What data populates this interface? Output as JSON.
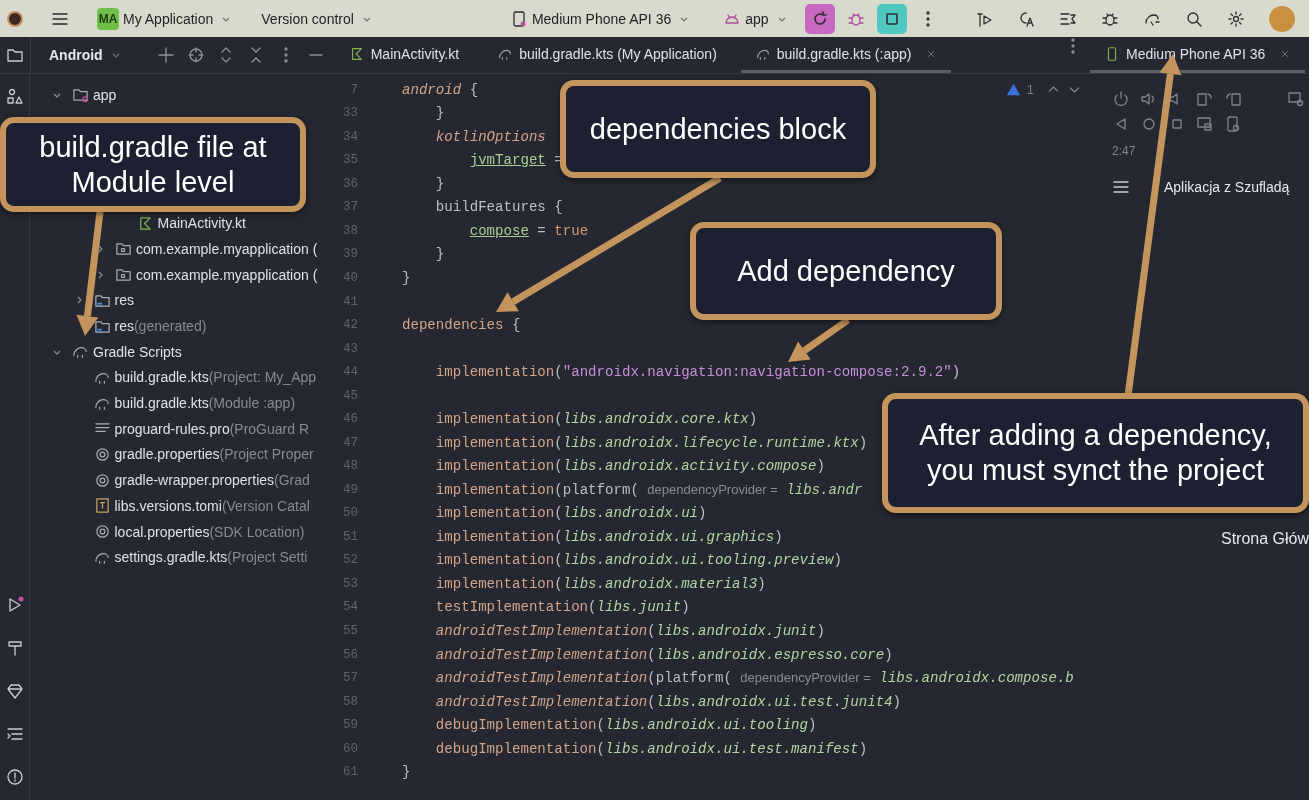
{
  "toolbar": {
    "project_badge": "MA",
    "project": "My Application",
    "vcs": "Version control",
    "device": "Medium Phone API 36",
    "run_config": "app"
  },
  "project_panel": {
    "view": "Android",
    "tree": [
      {
        "label": "app",
        "kind": "module",
        "expanded": true,
        "children": [
          {
            "kind": "covered",
            "children": [
              {
                "kind": "covered"
              }
            ]
          },
          {
            "kind": "covered",
            "children": [
              {
                "kind": "covered",
                "children": [
                  {
                    "label": "MainActivity.kt",
                    "kind": "kotlin"
                  }
                ]
              },
              {
                "label": "com.example.myapplication (",
                "kind": "package",
                "expanded": false
              },
              {
                "label": "com.example.myapplication (",
                "kind": "package",
                "expanded": false
              }
            ]
          },
          {
            "label": "res",
            "kind": "res",
            "expanded": false
          },
          {
            "label": "res",
            "hint": "(generated)",
            "kind": "res"
          }
        ]
      },
      {
        "label": "Gradle Scripts",
        "kind": "gradle",
        "expanded": true,
        "children": [
          {
            "label": "build.gradle.kts",
            "hint": "(Project: My_App",
            "kind": "gradle"
          },
          {
            "label": "build.gradle.kts",
            "hint": "(Module :app)",
            "kind": "gradle"
          },
          {
            "label": "proguard-rules.pro",
            "hint": "(ProGuard R",
            "kind": "text"
          },
          {
            "label": "gradle.properties",
            "hint": "(Project Proper",
            "kind": "settings"
          },
          {
            "label": "gradle-wrapper.properties",
            "hint": "(Grad",
            "kind": "settings"
          },
          {
            "label": "libs.versions.tomi",
            "hint": "(Version Catal",
            "kind": "catalog"
          },
          {
            "label": "local.properties",
            "hint": "(SDK Location)",
            "kind": "settings"
          },
          {
            "label": "settings.gradle.kts",
            "hint": "(Project Setti",
            "kind": "gradle"
          }
        ]
      }
    ]
  },
  "editor_tabs": [
    {
      "label": "MainActivity.kt",
      "kind": "kotlin",
      "selected": false
    },
    {
      "label": "build.gradle.kts (My Application)",
      "kind": "gradle",
      "selected": false
    },
    {
      "label": "build.gradle.kts (:app)",
      "kind": "gradle",
      "selected": true
    }
  ],
  "editor": {
    "warnings": "1",
    "lines": [
      {
        "number": "7",
        "tokens": [
          {
            "kind": "kw-i",
            "text": "android"
          },
          {
            "kind": "plain",
            "text": " {"
          }
        ]
      },
      {
        "number": "33",
        "tokens": [
          {
            "kind": "plain",
            "text": "    }"
          }
        ]
      },
      {
        "number": "34",
        "tokens": [
          {
            "kind": "kw-i",
            "text": "    kotlinOptions"
          }
        ]
      },
      {
        "number": "35",
        "tokens": [
          {
            "kind": "prop",
            "text": "        jvmTarget"
          },
          {
            "kind": "plain",
            "text": " ="
          }
        ]
      },
      {
        "number": "36",
        "tokens": [
          {
            "kind": "plain",
            "text": "    }"
          }
        ]
      },
      {
        "number": "37",
        "tokens": [
          {
            "kind": "plain",
            "text": "    buildFeatures {"
          }
        ]
      },
      {
        "number": "38",
        "tokens": [
          {
            "kind": "prop",
            "text": "        compose"
          },
          {
            "kind": "plain",
            "text": " = "
          },
          {
            "kind": "bool",
            "text": "true"
          }
        ]
      },
      {
        "number": "39",
        "tokens": [
          {
            "kind": "plain",
            "text": "    }"
          }
        ]
      },
      {
        "number": "40",
        "tokens": [
          {
            "kind": "plain",
            "text": "}"
          }
        ]
      },
      {
        "number": "41"
      },
      {
        "number": "42",
        "tokens": [
          {
            "kind": "fn",
            "text": "dependencies"
          },
          {
            "kind": "plain",
            "text": " {"
          }
        ]
      },
      {
        "number": "43"
      },
      {
        "number": "44",
        "tokens": [
          {
            "kind": "fn",
            "text": "    implementation"
          },
          {
            "kind": "plain",
            "text": "("
          },
          {
            "kind": "str",
            "text": "\"androidx.navigation:navigation-compose:2.9.2\""
          },
          {
            "kind": "plain",
            "text": ")"
          }
        ]
      },
      {
        "number": "45"
      },
      {
        "number": "46",
        "tokens": [
          {
            "kind": "fn",
            "text": "    implementation"
          },
          {
            "kind": "plain",
            "text": "("
          },
          {
            "kind": "ref",
            "text": "libs.androidx.core.ktx"
          },
          {
            "kind": "plain",
            "text": ")"
          }
        ]
      },
      {
        "number": "47",
        "tokens": [
          {
            "kind": "fn",
            "text": "    implementation"
          },
          {
            "kind": "plain",
            "text": "("
          },
          {
            "kind": "ref",
            "text": "libs.androidx.lifecycle.runtime.ktx"
          },
          {
            "kind": "plain",
            "text": ")"
          }
        ]
      },
      {
        "number": "48",
        "tokens": [
          {
            "kind": "fn",
            "text": "    implementation"
          },
          {
            "kind": "plain",
            "text": "("
          },
          {
            "kind": "ref",
            "text": "libs.androidx.activity.compose"
          },
          {
            "kind": "plain",
            "text": ")"
          }
        ]
      },
      {
        "number": "49",
        "tokens": [
          {
            "kind": "fn",
            "text": "    implementation"
          },
          {
            "kind": "plain",
            "text": "(platform( "
          },
          {
            "kind": "hint",
            "text": "dependencyProvider ="
          },
          {
            "kind": "ref",
            "text": " libs.andr"
          }
        ]
      },
      {
        "number": "50",
        "tokens": [
          {
            "kind": "fn",
            "text": "    implementation"
          },
          {
            "kind": "plain",
            "text": "("
          },
          {
            "kind": "ref",
            "text": "libs.androidx.ui"
          },
          {
            "kind": "plain",
            "text": ")"
          }
        ]
      },
      {
        "number": "51",
        "tokens": [
          {
            "kind": "fn",
            "text": "    implementation"
          },
          {
            "kind": "plain",
            "text": "("
          },
          {
            "kind": "ref",
            "text": "libs.androidx.ui.graphics"
          },
          {
            "kind": "plain",
            "text": ")"
          }
        ]
      },
      {
        "number": "52",
        "tokens": [
          {
            "kind": "fn",
            "text": "    implementation"
          },
          {
            "kind": "plain",
            "text": "("
          },
          {
            "kind": "ref",
            "text": "libs.androidx.ui.tooling.preview"
          },
          {
            "kind": "plain",
            "text": ")"
          }
        ]
      },
      {
        "number": "53",
        "tokens": [
          {
            "kind": "fn",
            "text": "    implementation"
          },
          {
            "kind": "plain",
            "text": "("
          },
          {
            "kind": "ref",
            "text": "libs.androidx.material3"
          },
          {
            "kind": "plain",
            "text": ")"
          }
        ]
      },
      {
        "number": "54",
        "tokens": [
          {
            "kind": "fn",
            "text": "    testImplementation"
          },
          {
            "kind": "plain",
            "text": "("
          },
          {
            "kind": "ref",
            "text": "libs.junit"
          },
          {
            "kind": "plain",
            "text": ")"
          }
        ]
      },
      {
        "number": "55",
        "tokens": [
          {
            "kind": "kw-i",
            "text": "    androidTestImplementation"
          },
          {
            "kind": "plain",
            "text": "("
          },
          {
            "kind": "ref",
            "text": "libs.androidx.junit"
          },
          {
            "kind": "plain",
            "text": ")"
          }
        ]
      },
      {
        "number": "56",
        "tokens": [
          {
            "kind": "kw-i",
            "text": "    androidTestImplementation"
          },
          {
            "kind": "plain",
            "text": "("
          },
          {
            "kind": "ref",
            "text": "libs.androidx.espresso.core"
          },
          {
            "kind": "plain",
            "text": ")"
          }
        ]
      },
      {
        "number": "57",
        "tokens": [
          {
            "kind": "kw-i",
            "text": "    androidTestImplementation"
          },
          {
            "kind": "plain",
            "text": "(platform( "
          },
          {
            "kind": "hint",
            "text": "dependencyProvider ="
          },
          {
            "kind": "ref",
            "text": " libs.androidx.compose.b"
          }
        ]
      },
      {
        "number": "58",
        "tokens": [
          {
            "kind": "kw-i",
            "text": "    androidTestImplementation"
          },
          {
            "kind": "plain",
            "text": "("
          },
          {
            "kind": "ref",
            "text": "libs.androidx.ui.test.junit4"
          },
          {
            "kind": "plain",
            "text": ")"
          }
        ]
      },
      {
        "number": "59",
        "tokens": [
          {
            "kind": "fn",
            "text": "    debugImplementation"
          },
          {
            "kind": "plain",
            "text": "("
          },
          {
            "kind": "ref",
            "text": "libs.androidx.ui.tooling"
          },
          {
            "kind": "plain",
            "text": ")"
          }
        ]
      },
      {
        "number": "60",
        "tokens": [
          {
            "kind": "fn",
            "text": "    debugImplementation"
          },
          {
            "kind": "plain",
            "text": "("
          },
          {
            "kind": "ref",
            "text": "libs.androidx.ui.test.manifest"
          },
          {
            "kind": "plain",
            "text": ")"
          }
        ]
      },
      {
        "number": "61",
        "tokens": [
          {
            "kind": "plain",
            "text": "}"
          }
        ]
      }
    ]
  },
  "running_devices": {
    "tab": "Medium Phone API 36",
    "time": "2:47",
    "app_title": "Aplikacja z Szufladą",
    "drawer_item": "Strona Głów"
  },
  "callouts": [
    {
      "text": "build.gradle file at Module level"
    },
    {
      "text": "dependencies block"
    },
    {
      "text": "Add dependency"
    },
    {
      "text": "After adding a dependency, you must synct the project"
    }
  ]
}
